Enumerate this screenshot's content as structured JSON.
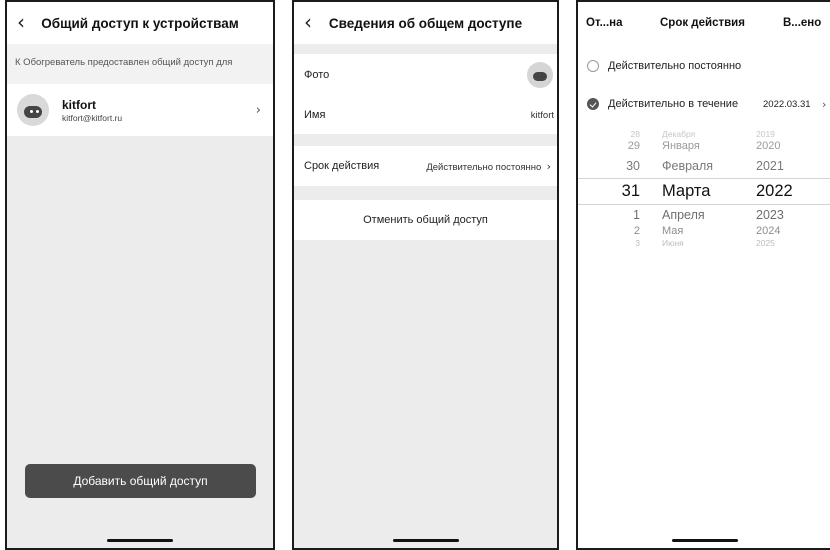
{
  "screen1": {
    "back_icon": "chevron-left-icon",
    "title": "Общий доступ к устройствам",
    "note": "К Обогреватель предоставлен общий доступ для",
    "user": {
      "name": "kitfort",
      "email": "kitfort@kitfort.ru"
    },
    "chevron": "›",
    "add_button": "Добавить общий доступ"
  },
  "screen2": {
    "back_icon": "chevron-left-icon",
    "title": "Сведения об общем доступе",
    "photo_label": "Фото",
    "name_label": "Имя",
    "name_value": "kitfort",
    "validity_label": "Срок действия",
    "validity_value": "Действительно постоянно",
    "chevron": "›",
    "cancel_label": "Отменить общий доступ"
  },
  "screen3": {
    "tab_left": "От...на",
    "tab_title": "Срок действия",
    "tab_right": "В...ено",
    "option_permanent": "Действительно постоянно",
    "option_period": "Действительно в течение",
    "period_date": "2022.03.31",
    "chevron": "›",
    "picker": {
      "rows": [
        {
          "day": "28",
          "month": "Декабря",
          "year": "2019"
        },
        {
          "day": "29",
          "month": "Января",
          "year": "2020"
        },
        {
          "day": "30",
          "month": "Февраля",
          "year": "2021"
        },
        {
          "day": "31",
          "month": "Марта",
          "year": "2022"
        },
        {
          "day": "1",
          "month": "Апреля",
          "year": "2023"
        },
        {
          "day": "2",
          "month": "Мая",
          "year": "2024"
        },
        {
          "day": "3",
          "month": "Июня",
          "year": "2025"
        }
      ],
      "selected_index": 3
    }
  },
  "colors": {
    "button_bg": "#4b4b4b",
    "screen_bg": "#ececec",
    "checked_radio": "#555555"
  }
}
